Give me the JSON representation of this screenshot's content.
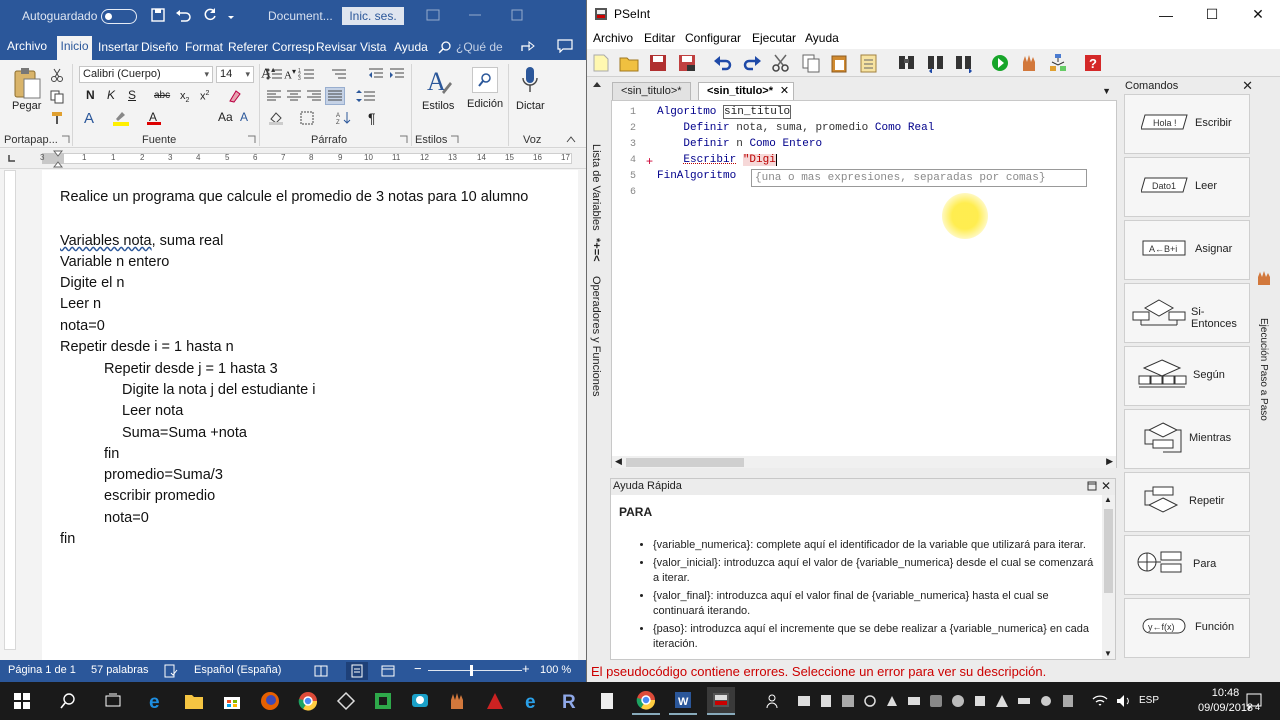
{
  "word": {
    "autosave": "Autoguardado",
    "doc_name": "Document...",
    "signin": "Inic. ses.",
    "tabs": [
      "Archivo",
      "Inicio",
      "Insertar",
      "Diseño",
      "Formato",
      "Referencias",
      "Correspondencia",
      "Revisar",
      "Vista",
      "Ayuda"
    ],
    "tab_visible": [
      "Archivo",
      "Inicio",
      "Insertar",
      "Diseño",
      "Format",
      "Referer",
      "Corresp",
      "Revisar",
      "Vista",
      "Ayuda"
    ],
    "tell_me": "¿Qué de",
    "ribbon": {
      "paste": "Pegar",
      "clipboard": "Portapap...",
      "font_group": "Fuente",
      "font_name": "Calibri (Cuerpo)",
      "font_size": "14",
      "paragraph_group": "Párrafo",
      "styles_btn": "Estilos",
      "styles_group": "Estilos",
      "editing_btn": "Edición",
      "dictate_btn": "Dictar",
      "voice_group": "Voz"
    },
    "document_lines": [
      "Realice un programa que calcule el promedio de 3 notas para 10 alumno",
      "",
      "Variables nota, suma real",
      "Variable n entero",
      "Digite el n",
      "Leer n",
      "nota=0",
      "Repetir desde i = 1 hasta n",
      "Repetir desde j = 1 hasta 3",
      "Digite la nota j del estudiante i",
      "Leer nota",
      "Suma=Suma +nota",
      "fin",
      "promedio=Suma/3",
      "escribir promedio",
      "nota=0",
      "fin"
    ],
    "status": {
      "page": "Página 1 de 1",
      "words": "57 palabras",
      "language": "Español (España)",
      "zoom": "100 %"
    }
  },
  "pseint": {
    "title": "PSeInt",
    "menu": [
      "Archivo",
      "Editar",
      "Configurar",
      "Ejecutar",
      "Ayuda"
    ],
    "side_tabs": [
      "Lista de Variables",
      "Operadores y Funciones"
    ],
    "side_tab_symbol": "*+=<",
    "editor_tabs": [
      "<sin_titulo>*",
      "<sin_titulo>*"
    ],
    "code": {
      "line_numbers": [
        "1",
        "2",
        "3",
        "4",
        "5",
        "6"
      ],
      "l1_kw": "Algoritmo",
      "l1_name": "sin_titulo",
      "l2_kw": "Definir",
      "l2_vars": "nota, suma, promedio",
      "l2_kw2": "Como",
      "l2_type": "Real",
      "l3_kw": "Definir",
      "l3_vars": "n",
      "l3_kw2": "Como",
      "l3_type": "Entero",
      "l4_kw": "Escribir",
      "l4_arg": "\"Digi",
      "l5_kw": "FinAlgoritmo"
    },
    "tooltip": "{una o mas expresiones, separadas por comas}",
    "help": {
      "title": "Ayuda Rápida",
      "heading": "PARA",
      "items": [
        "{variable_numerica}: complete aquí el identificador de la variable que utilizará para iterar.",
        "{valor_inicial}: introduzca aquí el valor de {variable_numerica} desde el cual se comenzará a iterar.",
        "{valor_final}: introduzca aquí el valor final de {variable_numerica} hasta el cual se continuará iterando.",
        "{paso}: introduzca aquí el incremente que se debe realizar a {variable_numerica} en cada iteración."
      ]
    },
    "commands_title": "Comandos",
    "commands": [
      {
        "label": "Escribir",
        "icon_text": "Hola !"
      },
      {
        "label": "Leer",
        "icon_text": "Dato1"
      },
      {
        "label": "Asignar",
        "icon_text": "A←B+i"
      },
      {
        "label": "Si-Entonces",
        "icon_text": ""
      },
      {
        "label": "Según",
        "icon_text": ""
      },
      {
        "label": "Mientras",
        "icon_text": ""
      },
      {
        "label": "Repetir",
        "icon_text": ""
      },
      {
        "label": "Para",
        "icon_text": ""
      },
      {
        "label": "Función",
        "icon_text": "y←f(x)"
      }
    ],
    "step_tab": "Ejecución Paso a Paso",
    "error_bar": "El pseudocódigo contiene errores. Seleccione un error para ver su descripción."
  },
  "taskbar": {
    "language": "ESP",
    "time": "10:48",
    "date": "09/09/2018",
    "notifications": "4",
    "pinned": [
      "start-icon",
      "search-icon",
      "task-view-icon",
      "edge-icon",
      "file-explorer-icon",
      "store-icon",
      "firefox-icon",
      "chrome-icon",
      "app-icon",
      "camtasia-icon",
      "app-icon",
      "app-icon",
      "app-icon",
      "ie-icon",
      "files-icon",
      "r-icon",
      "notes-icon",
      "chrome-icon",
      "word-icon",
      "pseint-icon"
    ]
  },
  "colors": {
    "word_blue": "#2b579a",
    "pseint_keyword": "#00008b",
    "error_red": "#cc0000"
  }
}
